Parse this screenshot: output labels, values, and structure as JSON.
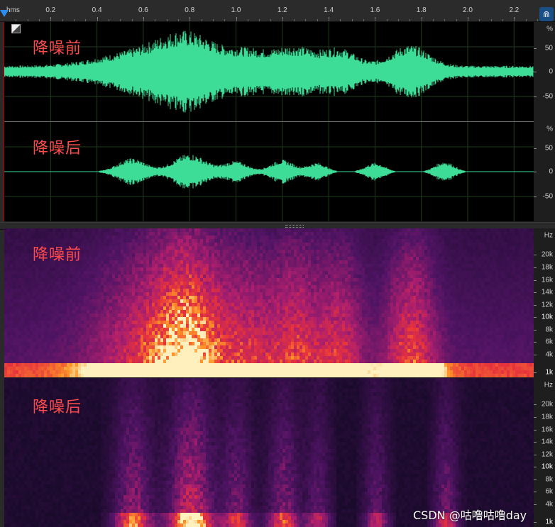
{
  "ruler": {
    "unit": "hms",
    "ticks": [
      "0.2",
      "0.4",
      "0.6",
      "0.8",
      "1.0",
      "1.2",
      "1.4",
      "1.6",
      "1.8",
      "2.0",
      "2.2"
    ]
  },
  "waveform": {
    "before_label": "降噪前",
    "after_label": "降噪后",
    "scale": [
      "%",
      "50",
      "0",
      "-50",
      "%",
      "50",
      "0",
      "-50"
    ]
  },
  "spectrogram": {
    "before_label": "降噪前",
    "after_label": "降噪后",
    "scale": [
      "Hz",
      "20k",
      "18k",
      "16k",
      "14k",
      "12k",
      "10k",
      "8k",
      "6k",
      "4k",
      "1k"
    ]
  },
  "watermark": "CSDN @咕噜咕噜day",
  "colors": {
    "waveform": "#3ddc97",
    "label": "#ff4b4b",
    "grid": "#1f3b1f",
    "accent": "#2d8cf0"
  },
  "icons": {
    "playhead": "playhead-marker-icon",
    "snap": "magnet-icon",
    "toggle": "corner-toggle-icon"
  }
}
